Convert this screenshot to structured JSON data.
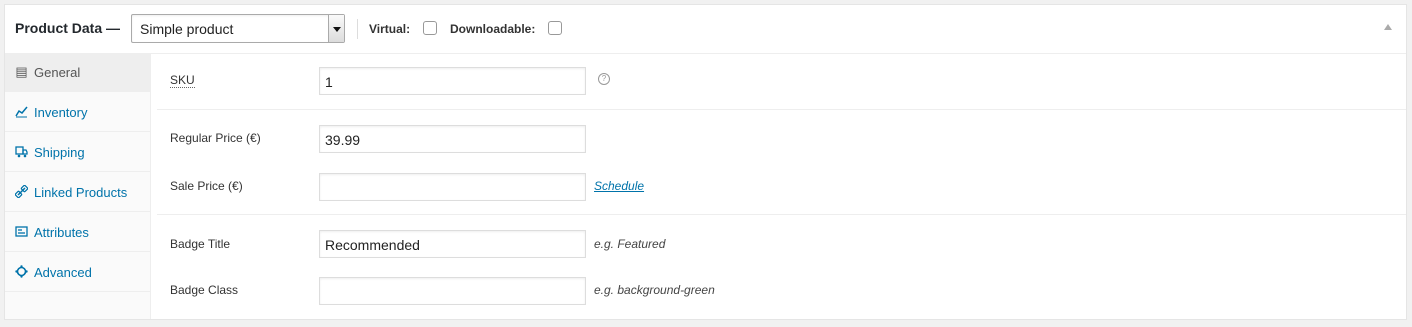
{
  "header": {
    "title": "Product Data —",
    "product_type": "Simple product",
    "virtual_label": "Virtual:",
    "downloadable_label": "Downloadable:"
  },
  "tabs": [
    {
      "label": "General",
      "icon": "general-icon"
    },
    {
      "label": "Inventory",
      "icon": "inventory-icon"
    },
    {
      "label": "Shipping",
      "icon": "shipping-icon"
    },
    {
      "label": "Linked Products",
      "icon": "link-icon"
    },
    {
      "label": "Attributes",
      "icon": "attributes-icon"
    },
    {
      "label": "Advanced",
      "icon": "gear-icon"
    }
  ],
  "fields": {
    "sku": {
      "label": "SKU",
      "value": "1"
    },
    "regular_price": {
      "label": "Regular Price (€)",
      "value": "39.99"
    },
    "sale_price": {
      "label": "Sale Price (€)",
      "value": "",
      "link": "Schedule"
    },
    "badge_title": {
      "label": "Badge Title",
      "value": "Recommended",
      "hint": "e.g. Featured"
    },
    "badge_class": {
      "label": "Badge Class",
      "value": "",
      "hint": "e.g. background-green"
    }
  },
  "colors": {
    "link": "#0073aa",
    "active_tab_bg": "#eeeeee"
  }
}
